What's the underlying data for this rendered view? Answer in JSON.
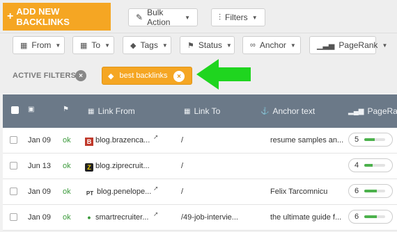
{
  "toolbar": {
    "add_label": "ADD NEW BACKLINKS",
    "bulk_label": "Bulk Action",
    "filters_label": "Filters"
  },
  "filters": {
    "from": "From",
    "to": "To",
    "tags": "Tags",
    "status": "Status",
    "anchor": "Anchor",
    "pagerank": "PageRank"
  },
  "active_filters": {
    "label": "ACTIVE FILTERS",
    "clear_glyph": "×",
    "chip_label": "best backlinks",
    "chip_remove_glyph": "×"
  },
  "table": {
    "headers": {
      "link_from": "Link From",
      "link_to": "Link To",
      "anchor_text": "Anchor text",
      "pagerank": "PageRank"
    },
    "rows": [
      {
        "date": "Jan 09",
        "status": "ok",
        "favicon": "B",
        "link_from": "blog.brazenca...",
        "link_to": "/",
        "anchor": "resume samples an...",
        "pagerank": "5",
        "pr_fraction": 0.5
      },
      {
        "date": "Jun 13",
        "status": "ok",
        "favicon": "Z",
        "link_from": "blog.ziprecruit...",
        "link_to": "/",
        "anchor": "",
        "pagerank": "4",
        "pr_fraction": 0.4
      },
      {
        "date": "Jan 09",
        "status": "ok",
        "favicon": "PT",
        "link_from": "blog.penelope...",
        "link_to": "/",
        "anchor": "Felix Tarcomnicu",
        "pagerank": "6",
        "pr_fraction": 0.6
      },
      {
        "date": "Jan 09",
        "status": "ok",
        "favicon": "•",
        "link_from": "smartrecruiter...",
        "link_to": "/49-job-intervie...",
        "anchor": "the ultimate guide f...",
        "pagerank": "6",
        "pr_fraction": 0.6
      }
    ]
  },
  "colors": {
    "accent": "#f5a623",
    "header_bg": "#6b7988",
    "ok": "#3b9a3b",
    "arrow": "#1fd51f"
  }
}
